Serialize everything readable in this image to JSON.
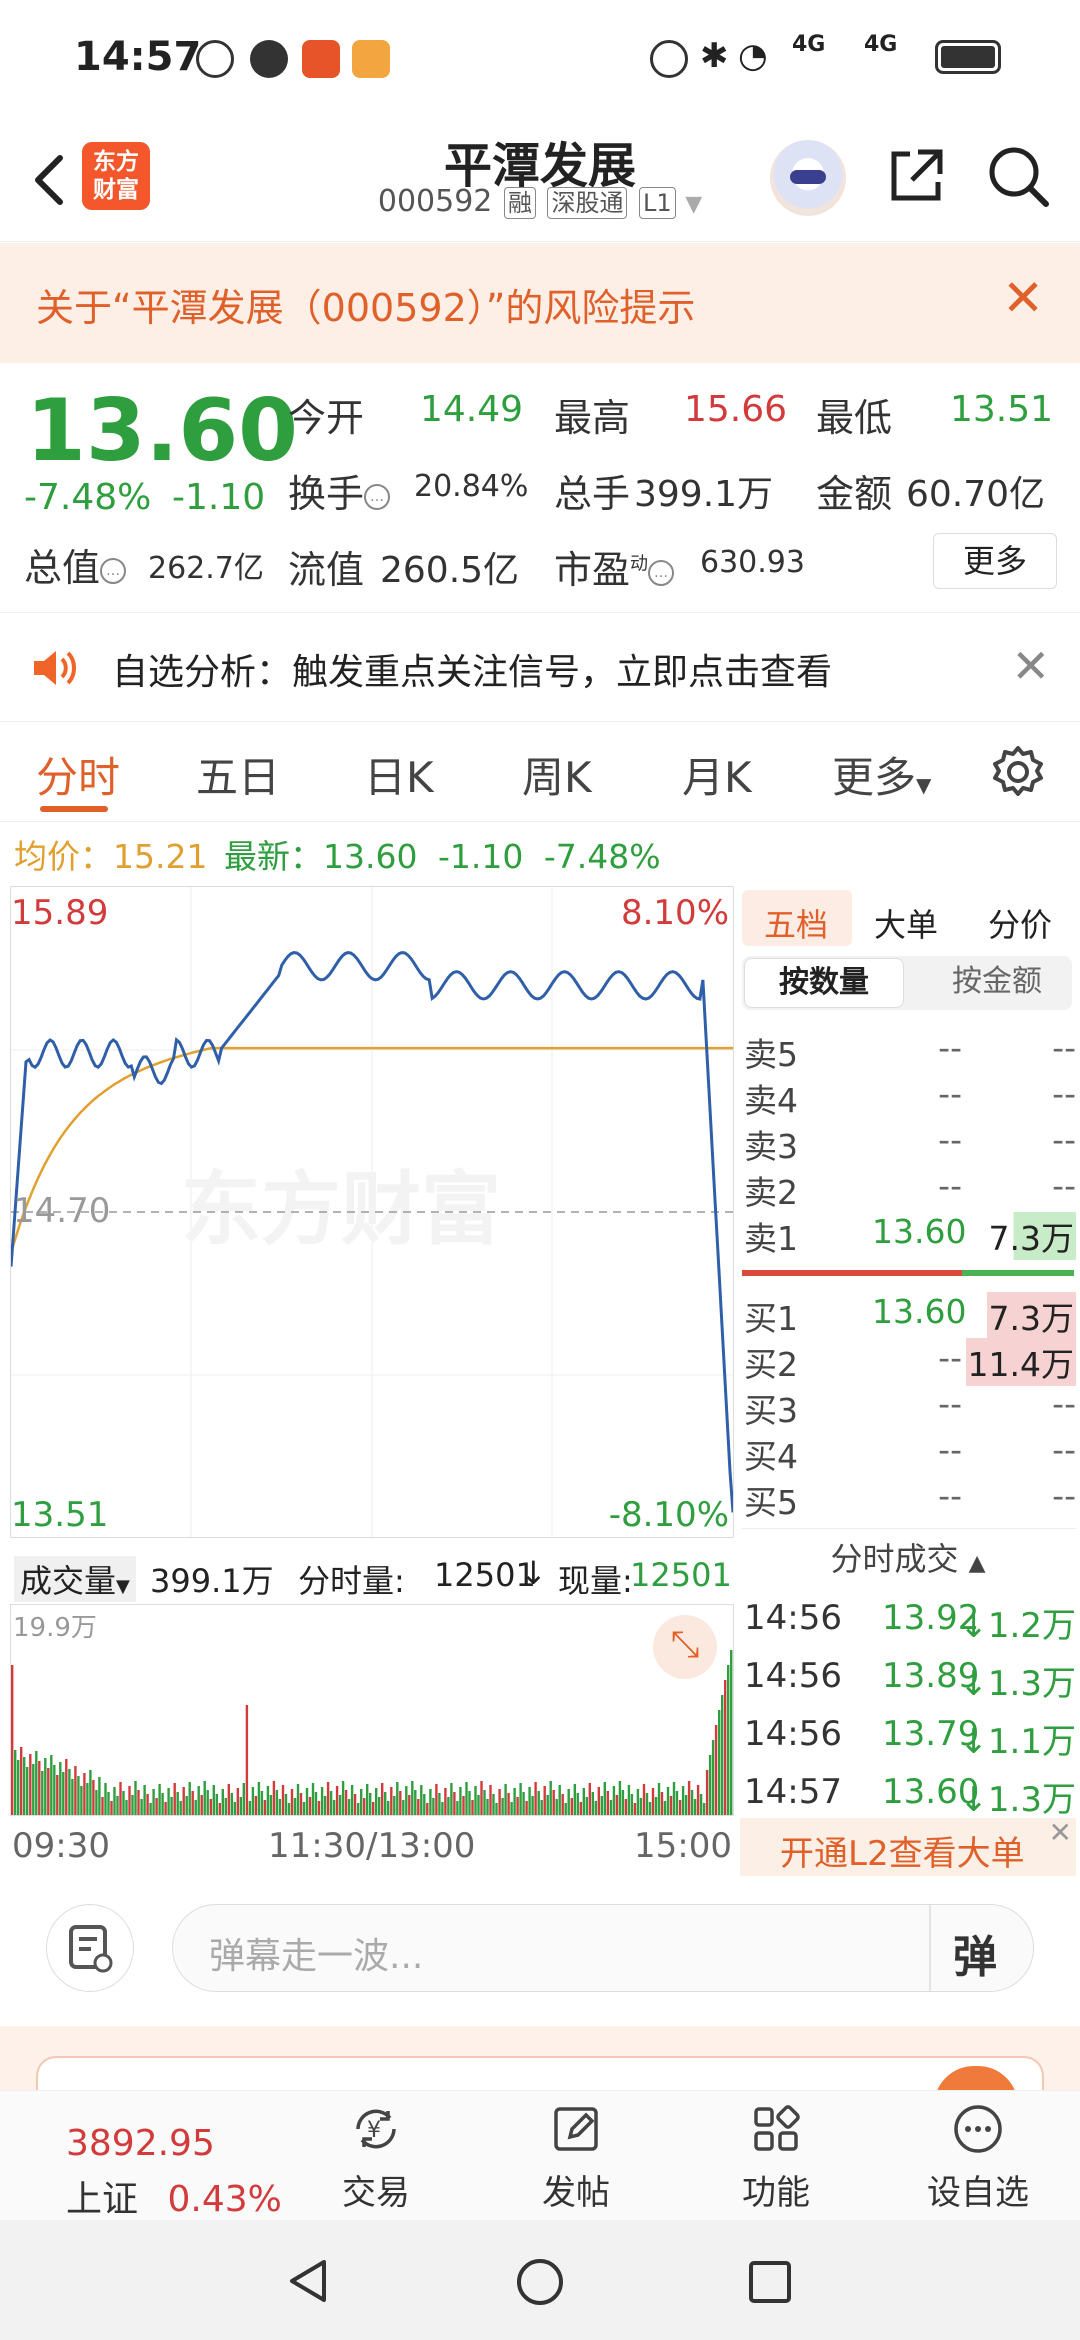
{
  "status_bar": {
    "time": "14:57",
    "network1": "4G",
    "network2": "4G"
  },
  "header": {
    "logo_text_1": "东方",
    "logo_text_2": "财富",
    "stock_name": "平潭发展",
    "stock_code": "000592",
    "tags": [
      "融",
      "深股通",
      "L1"
    ]
  },
  "risk_banner": {
    "text": "关于“平潭发展（000592）”的风险提示"
  },
  "quote": {
    "price": "13.60",
    "change_pct": "-7.48%",
    "change": "-1.10",
    "open_label": "今开",
    "open": "14.49",
    "high_label": "最高",
    "high": "15.66",
    "low_label": "最低",
    "low": "13.51",
    "turnover_label": "换手",
    "turnover": "20.84%",
    "volume_label": "总手",
    "volume": "399.1万",
    "amount_label": "金额",
    "amount": "60.70亿",
    "mktcap_label": "总值",
    "mktcap": "262.7亿",
    "float_label": "流值",
    "float": "260.5亿",
    "pe_label": "市盈",
    "pe_sup": "动",
    "pe": "630.93",
    "more": "更多"
  },
  "analysis_banner": {
    "text": "自选分析：触发重点关注信号，立即点击查看"
  },
  "tabs": [
    "分时",
    "五日",
    "日K",
    "周K",
    "月K",
    "更多"
  ],
  "avg_line": {
    "avg_label": "均价：",
    "avg": "15.21",
    "latest_label": "最新：",
    "latest": "13.60",
    "chg": "-1.10",
    "pct": "-7.48%"
  },
  "chart_labels": {
    "top_price": "15.89",
    "top_pct": "8.10%",
    "mid_price": "14.70",
    "bottom_price": "13.51",
    "bottom_pct": "-8.10%",
    "watermark": "东方财富"
  },
  "volume_bar": {
    "label": "成交量",
    "total": "399.1万",
    "ts_label": "分时量:",
    "ts_val": "12501",
    "now_label": "现量:",
    "now_val": "12501",
    "max": "19.9万"
  },
  "time_axis": {
    "start": "09:30",
    "mid": "11:30/13:00",
    "end": "15:00"
  },
  "order_book": {
    "tabs": [
      "五档",
      "大单",
      "分价"
    ],
    "sub_tabs": [
      "按数量",
      "按金额"
    ],
    "asks": [
      {
        "label": "卖5",
        "price": "--",
        "vol": "--"
      },
      {
        "label": "卖4",
        "price": "--",
        "vol": "--"
      },
      {
        "label": "卖3",
        "price": "--",
        "vol": "--"
      },
      {
        "label": "卖2",
        "price": "--",
        "vol": "--"
      },
      {
        "label": "卖1",
        "price": "13.60",
        "vol": "7.3万"
      }
    ],
    "bids": [
      {
        "label": "买1",
        "price": "13.60",
        "vol": "7.3万"
      },
      {
        "label": "买2",
        "price": "--",
        "vol": "11.4万"
      },
      {
        "label": "买3",
        "price": "--",
        "vol": "--"
      },
      {
        "label": "买4",
        "price": "--",
        "vol": "--"
      },
      {
        "label": "买5",
        "price": "--",
        "vol": "--"
      }
    ],
    "ticks_title": "分时成交",
    "ticks": [
      {
        "time": "14:56",
        "price": "13.92",
        "vol": "1.2万"
      },
      {
        "time": "14:56",
        "price": "13.89",
        "vol": "1.3万"
      },
      {
        "time": "14:56",
        "price": "13.79",
        "vol": "1.1万"
      },
      {
        "time": "14:57",
        "price": "13.60",
        "vol": "1.3万"
      }
    ],
    "l2_banner": "开通L2查看大单"
  },
  "danmu": {
    "placeholder": "弹幕走一波...",
    "send_label": "弹"
  },
  "bottom_nav": {
    "index_value": "3892.95",
    "index_name": "上证",
    "index_pct": "0.43%",
    "items": [
      "交易",
      "发帖",
      "功能",
      "设自选"
    ]
  },
  "colors": {
    "accent": "#e0602a",
    "up": "#d23b3b",
    "down": "#2f9e3f",
    "avg": "#e0a030",
    "price_line": "#2f5fa8"
  }
}
